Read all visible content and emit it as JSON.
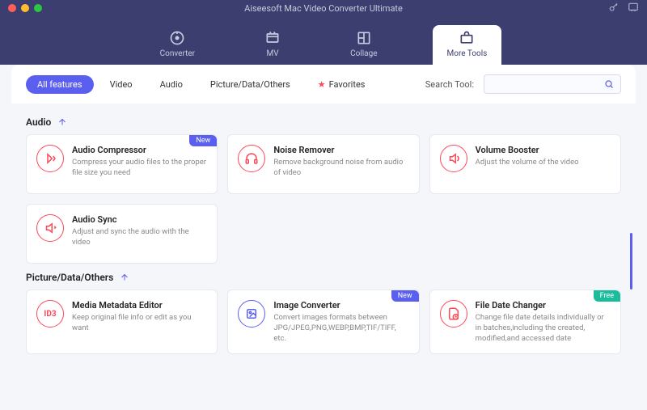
{
  "title": "Aiseesoft Mac Video Converter Ultimate",
  "nav": {
    "converter": "Converter",
    "mv": "MV",
    "collage": "Collage",
    "more": "More Tools"
  },
  "tabs": {
    "all": "All features",
    "video": "Video",
    "audio": "Audio",
    "picture": "Picture/Data/Others",
    "favorites": "Favorites"
  },
  "search": {
    "label": "Search Tool:",
    "placeholder": ""
  },
  "sections": {
    "audio": "Audio",
    "picture": "Picture/Data/Others"
  },
  "badges": {
    "new": "New",
    "free": "Free"
  },
  "cards": {
    "audio_compressor": {
      "title": "Audio Compressor",
      "desc": "Compress your audio files to the proper file size you need"
    },
    "noise_remover": {
      "title": "Noise Remover",
      "desc": "Remove background noise from audio of video"
    },
    "volume_booster": {
      "title": "Volume Booster",
      "desc": "Adjust the volume of the video"
    },
    "audio_sync": {
      "title": "Audio Sync",
      "desc": "Adjust and sync the audio with the video"
    },
    "metadata": {
      "title": "Media Metadata Editor",
      "desc": "Keep original file info or edit as you want"
    },
    "image_conv": {
      "title": "Image Converter",
      "desc": "Convert images formats between JPG/JPEG,PNG,WEBP,BMP,TIF/TIFF, etc."
    },
    "file_date": {
      "title": "File Date Changer",
      "desc": "Change file date details individually or in batches,including the created, modified,and accessed date"
    }
  }
}
